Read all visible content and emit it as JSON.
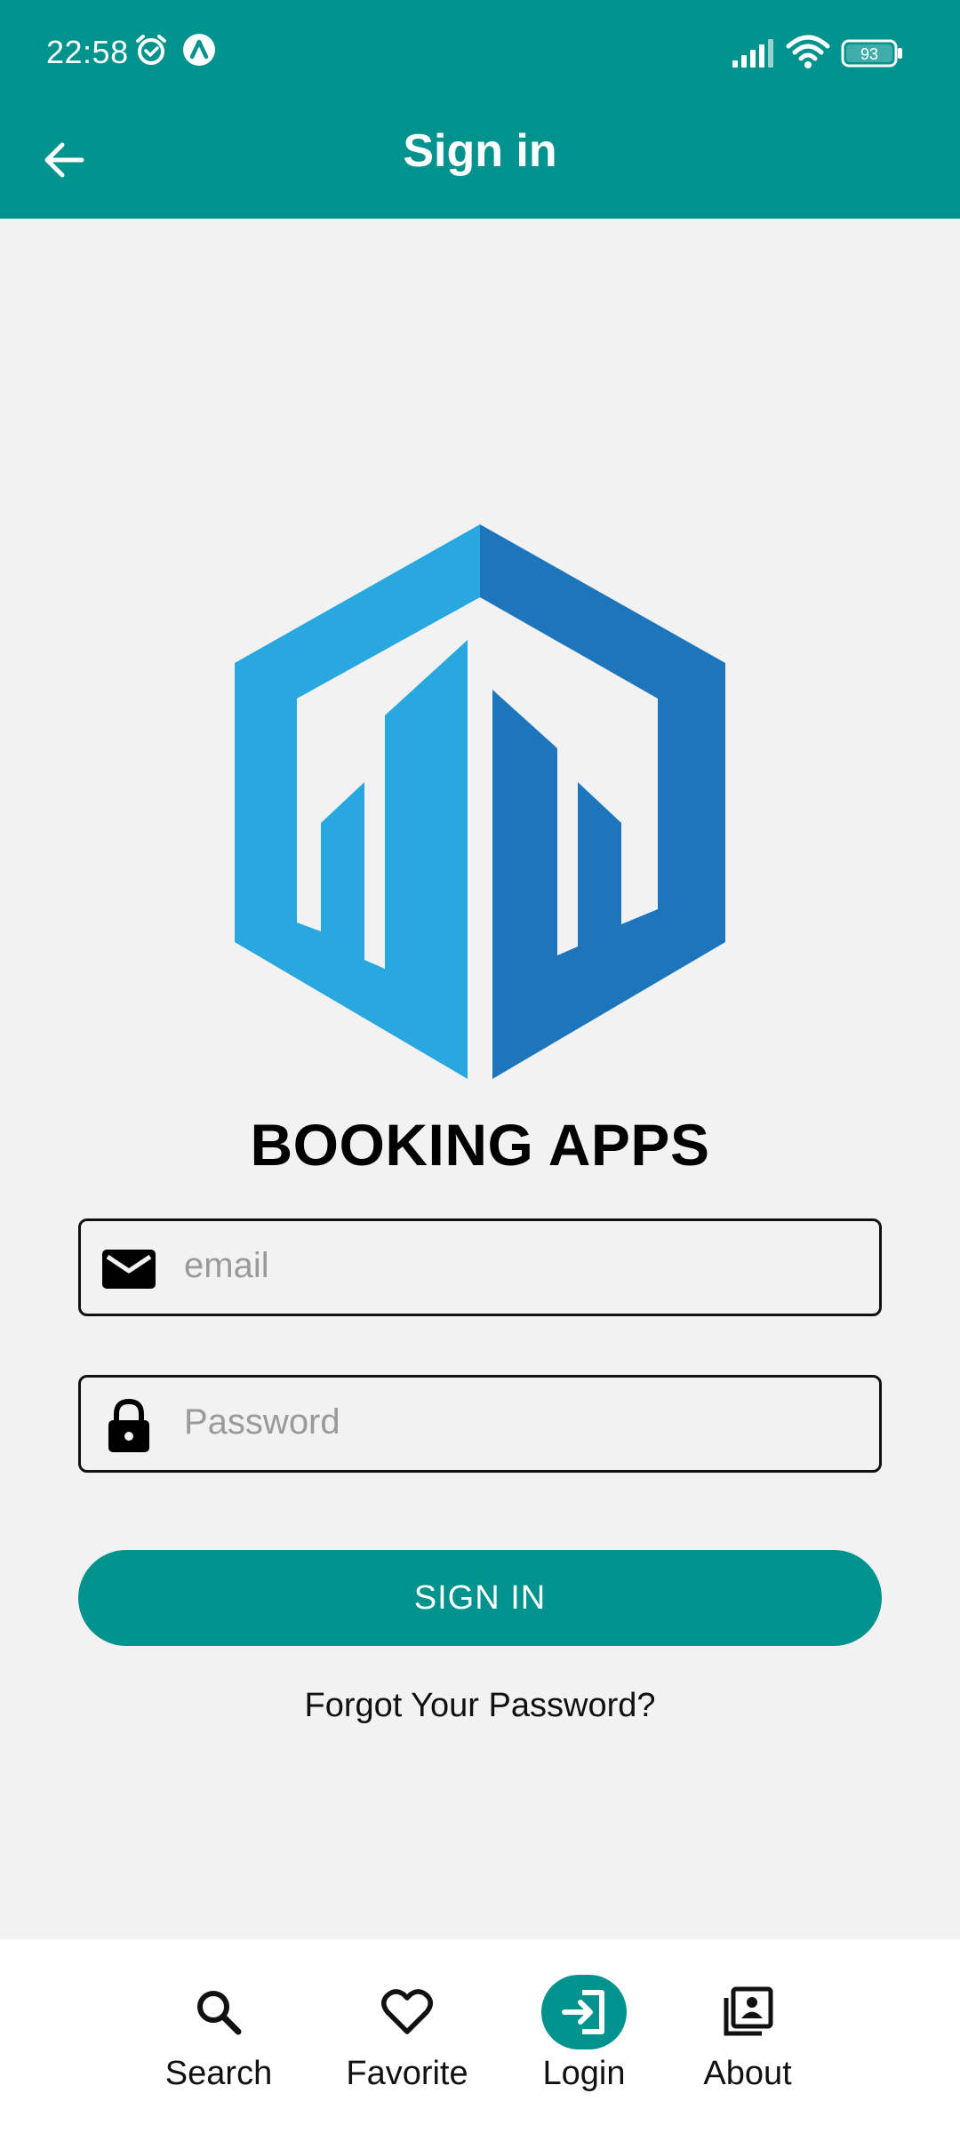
{
  "status_bar": {
    "time": "22:58",
    "battery": "93",
    "icons": [
      "alarm-icon",
      "app-notification-icon",
      "signal-icon",
      "wifi-icon",
      "battery-icon"
    ]
  },
  "appbar": {
    "title": "Sign in",
    "back_icon": "arrow-left-icon"
  },
  "brand": {
    "title": "BOOKING APPS",
    "logo_colors": [
      "#29a8e0",
      "#1d76bb"
    ]
  },
  "form": {
    "email": {
      "value": "",
      "placeholder": "email",
      "icon": "mail-icon"
    },
    "password": {
      "value": "",
      "placeholder": "Password",
      "icon": "lock-icon"
    },
    "submit_label": "SIGN IN",
    "forgot_label": "Forgot Your Password?"
  },
  "bottom_nav": {
    "items": [
      {
        "label": "Search",
        "icon": "search-icon",
        "active": false
      },
      {
        "label": "Favorite",
        "icon": "heart-icon",
        "active": false
      },
      {
        "label": "Login",
        "icon": "login-icon",
        "active": true
      },
      {
        "label": "About",
        "icon": "contacts-icon",
        "active": false
      }
    ]
  },
  "colors": {
    "primary": "#00928c",
    "background": "#f2f2f2",
    "nav_background": "#ffffff"
  }
}
